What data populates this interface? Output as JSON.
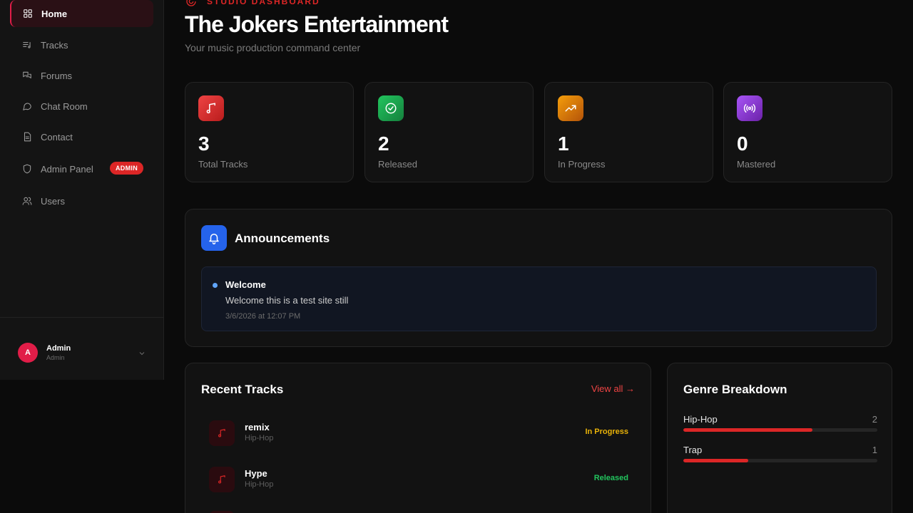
{
  "sidebar": {
    "items": [
      {
        "label": "Home",
        "icon": "grid-icon"
      },
      {
        "label": "Tracks",
        "icon": "list-music-icon"
      },
      {
        "label": "Forums",
        "icon": "messages-icon"
      },
      {
        "label": "Chat Room",
        "icon": "chat-bubble-icon"
      },
      {
        "label": "Contact",
        "icon": "document-icon"
      },
      {
        "label": "Admin Panel",
        "icon": "shield-icon",
        "badge": "ADMIN"
      },
      {
        "label": "Users",
        "icon": "users-icon"
      }
    ],
    "user": {
      "initial": "A",
      "name": "Admin",
      "role": "Admin"
    }
  },
  "header": {
    "eyebrow": "STUDIO DASHBOARD",
    "title": "The Jokers Entertainment",
    "subtitle": "Your music production command center"
  },
  "stats": [
    {
      "value": "3",
      "label": "Total Tracks",
      "color": "#dc2626",
      "icon": "music-note-icon"
    },
    {
      "value": "2",
      "label": "Released",
      "color": "#16a34a",
      "icon": "check-circle-icon"
    },
    {
      "value": "1",
      "label": "In Progress",
      "color": "#d97706",
      "icon": "trending-up-icon"
    },
    {
      "value": "0",
      "label": "Mastered",
      "color": "#7e22ce",
      "icon": "broadcast-icon"
    }
  ],
  "announcements": {
    "title": "Announcements",
    "items": [
      {
        "title": "Welcome",
        "body": "Welcome this is a test site still",
        "date": "3/6/2026 at 12:07 PM"
      }
    ]
  },
  "recent_tracks": {
    "title": "Recent Tracks",
    "view_all": "View all →",
    "items": [
      {
        "name": "remix",
        "genre": "Hip-Hop",
        "status": "In Progress",
        "status_color": "#eab308"
      },
      {
        "name": "Hype",
        "genre": "Hip-Hop",
        "status": "Released",
        "status_color": "#22c55e"
      }
    ]
  },
  "genre_breakdown": {
    "title": "Genre Breakdown",
    "items": [
      {
        "name": "Hip-Hop",
        "count": "2",
        "fraction": 0.667
      },
      {
        "name": "Trap",
        "count": "1",
        "fraction": 0.333
      }
    ]
  }
}
